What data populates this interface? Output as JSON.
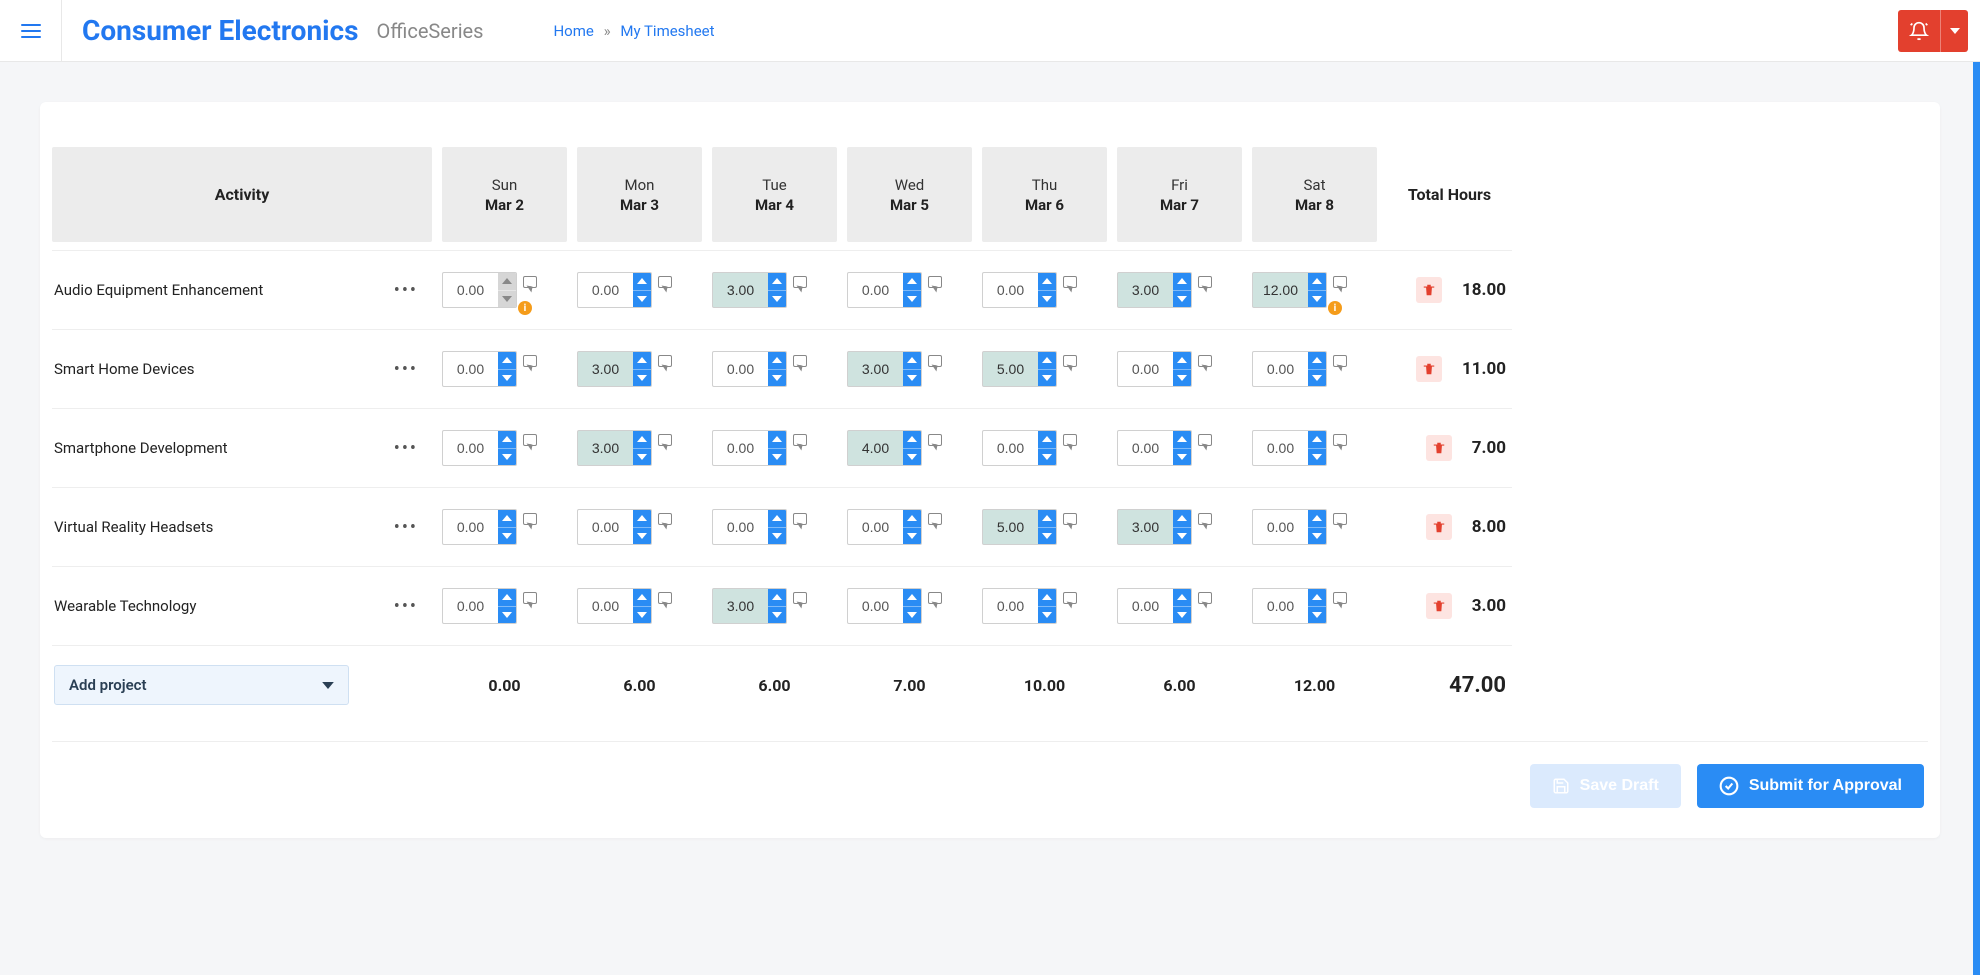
{
  "header": {
    "brand": "Consumer Electronics",
    "subtitle": "OfficeSeries",
    "breadcrumb_home": "Home",
    "breadcrumb_sep": "»",
    "breadcrumb_current": "My Timesheet"
  },
  "table": {
    "activity_header": "Activity",
    "total_header": "Total Hours",
    "days": [
      {
        "dow": "Sun",
        "date": "Mar 2"
      },
      {
        "dow": "Mon",
        "date": "Mar 3"
      },
      {
        "dow": "Tue",
        "date": "Mar 4"
      },
      {
        "dow": "Wed",
        "date": "Mar 5"
      },
      {
        "dow": "Thu",
        "date": "Mar 6"
      },
      {
        "dow": "Fri",
        "date": "Mar 7"
      },
      {
        "dow": "Sat",
        "date": "Mar 8"
      }
    ],
    "rows": [
      {
        "name": "Audio Equipment Enhancement",
        "cells": [
          {
            "v": "0.00",
            "hl": false,
            "disabled": true,
            "warn": true
          },
          {
            "v": "0.00",
            "hl": false
          },
          {
            "v": "3.00",
            "hl": true
          },
          {
            "v": "0.00",
            "hl": false
          },
          {
            "v": "0.00",
            "hl": false
          },
          {
            "v": "3.00",
            "hl": true
          },
          {
            "v": "12.00",
            "hl": true,
            "warn": true
          }
        ],
        "total": "18.00"
      },
      {
        "name": "Smart Home Devices",
        "cells": [
          {
            "v": "0.00",
            "hl": false
          },
          {
            "v": "3.00",
            "hl": true
          },
          {
            "v": "0.00",
            "hl": false
          },
          {
            "v": "3.00",
            "hl": true
          },
          {
            "v": "5.00",
            "hl": true
          },
          {
            "v": "0.00",
            "hl": false
          },
          {
            "v": "0.00",
            "hl": false
          }
        ],
        "total": "11.00"
      },
      {
        "name": "Smartphone Development",
        "cells": [
          {
            "v": "0.00",
            "hl": false
          },
          {
            "v": "3.00",
            "hl": true
          },
          {
            "v": "0.00",
            "hl": false
          },
          {
            "v": "4.00",
            "hl": true
          },
          {
            "v": "0.00",
            "hl": false
          },
          {
            "v": "0.00",
            "hl": false
          },
          {
            "v": "0.00",
            "hl": false
          }
        ],
        "total": "7.00"
      },
      {
        "name": "Virtual Reality Headsets",
        "cells": [
          {
            "v": "0.00",
            "hl": false
          },
          {
            "v": "0.00",
            "hl": false
          },
          {
            "v": "0.00",
            "hl": false
          },
          {
            "v": "0.00",
            "hl": false
          },
          {
            "v": "5.00",
            "hl": true
          },
          {
            "v": "3.00",
            "hl": true
          },
          {
            "v": "0.00",
            "hl": false
          }
        ],
        "total": "8.00"
      },
      {
        "name": "Wearable Technology",
        "cells": [
          {
            "v": "0.00",
            "hl": false
          },
          {
            "v": "0.00",
            "hl": false
          },
          {
            "v": "3.00",
            "hl": true
          },
          {
            "v": "0.00",
            "hl": false
          },
          {
            "v": "0.00",
            "hl": false
          },
          {
            "v": "0.00",
            "hl": false
          },
          {
            "v": "0.00",
            "hl": false
          }
        ],
        "total": "3.00"
      }
    ],
    "add_project_label": "Add project",
    "day_totals": [
      "0.00",
      "6.00",
      "6.00",
      "7.00",
      "10.00",
      "6.00",
      "12.00"
    ],
    "grand_total": "47.00"
  },
  "actions": {
    "save_draft": "Save Draft",
    "submit": "Submit for Approval"
  }
}
